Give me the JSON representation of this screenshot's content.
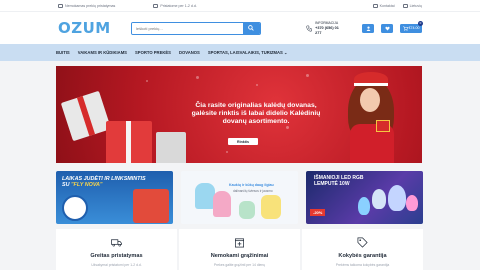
{
  "topbar": {
    "item1": "Nemokamas prekių pristatymas",
    "item2": "Pristatome per 1-2 d.d.",
    "right1": "Kontaktai",
    "right2": "Lietuvių"
  },
  "header": {
    "logo": "OZUM",
    "search_placeholder": "Ieškoti prekių...",
    "info_label": "INFORMACIJA",
    "phone": "+370 (656) 01 277",
    "cart_total": "€74.00",
    "cart_count": "0"
  },
  "nav": {
    "items": [
      "BUITIS",
      "VAIKAMS IR KŪDIKIAMS",
      "SPORTO PREKĖS",
      "DOVANOS",
      "SPORTAS, LAISVALAIKIS, TURIZMAS ⌄"
    ]
  },
  "hero": {
    "line1": "Čia rasite originalias kalėdų dovanas,",
    "line2": "galėsite rinktis iš labai didelio Kalėdinių",
    "line3": "dovanų asortimento.",
    "cta": "Rinktis"
  },
  "promos": {
    "p1_line1": "LAIKAS JUDĖTI IR LINKSMINTIS",
    "p1_line2a": "SU ",
    "p1_line2b": "\"FLY NOVA\"",
    "p2_line1": "Kaukių ir kūkų daug ilgiau",
    "p2_line2": "dalinančių šviesos ir jausmo",
    "p3_line1": "IŠMANIOJI LED RGB",
    "p3_line2": "LEMPUTĖ 10W",
    "p3_discount": "-20%"
  },
  "features": [
    {
      "label": "Greitas pristatymas",
      "sub": "Užsakymai pristatomi per 1-2 d.d."
    },
    {
      "label": "Nemokami grąžinimai",
      "sub": "Prekes galite grąžinti per 14 dienų"
    },
    {
      "label": "Kokybės garantija",
      "sub": "Prekėms taikoma kokybės garantija"
    }
  ],
  "colors": {
    "accent": "#3f8fe0",
    "nav_bg": "#c9ddf2",
    "hero_bg": "#c81d25"
  }
}
